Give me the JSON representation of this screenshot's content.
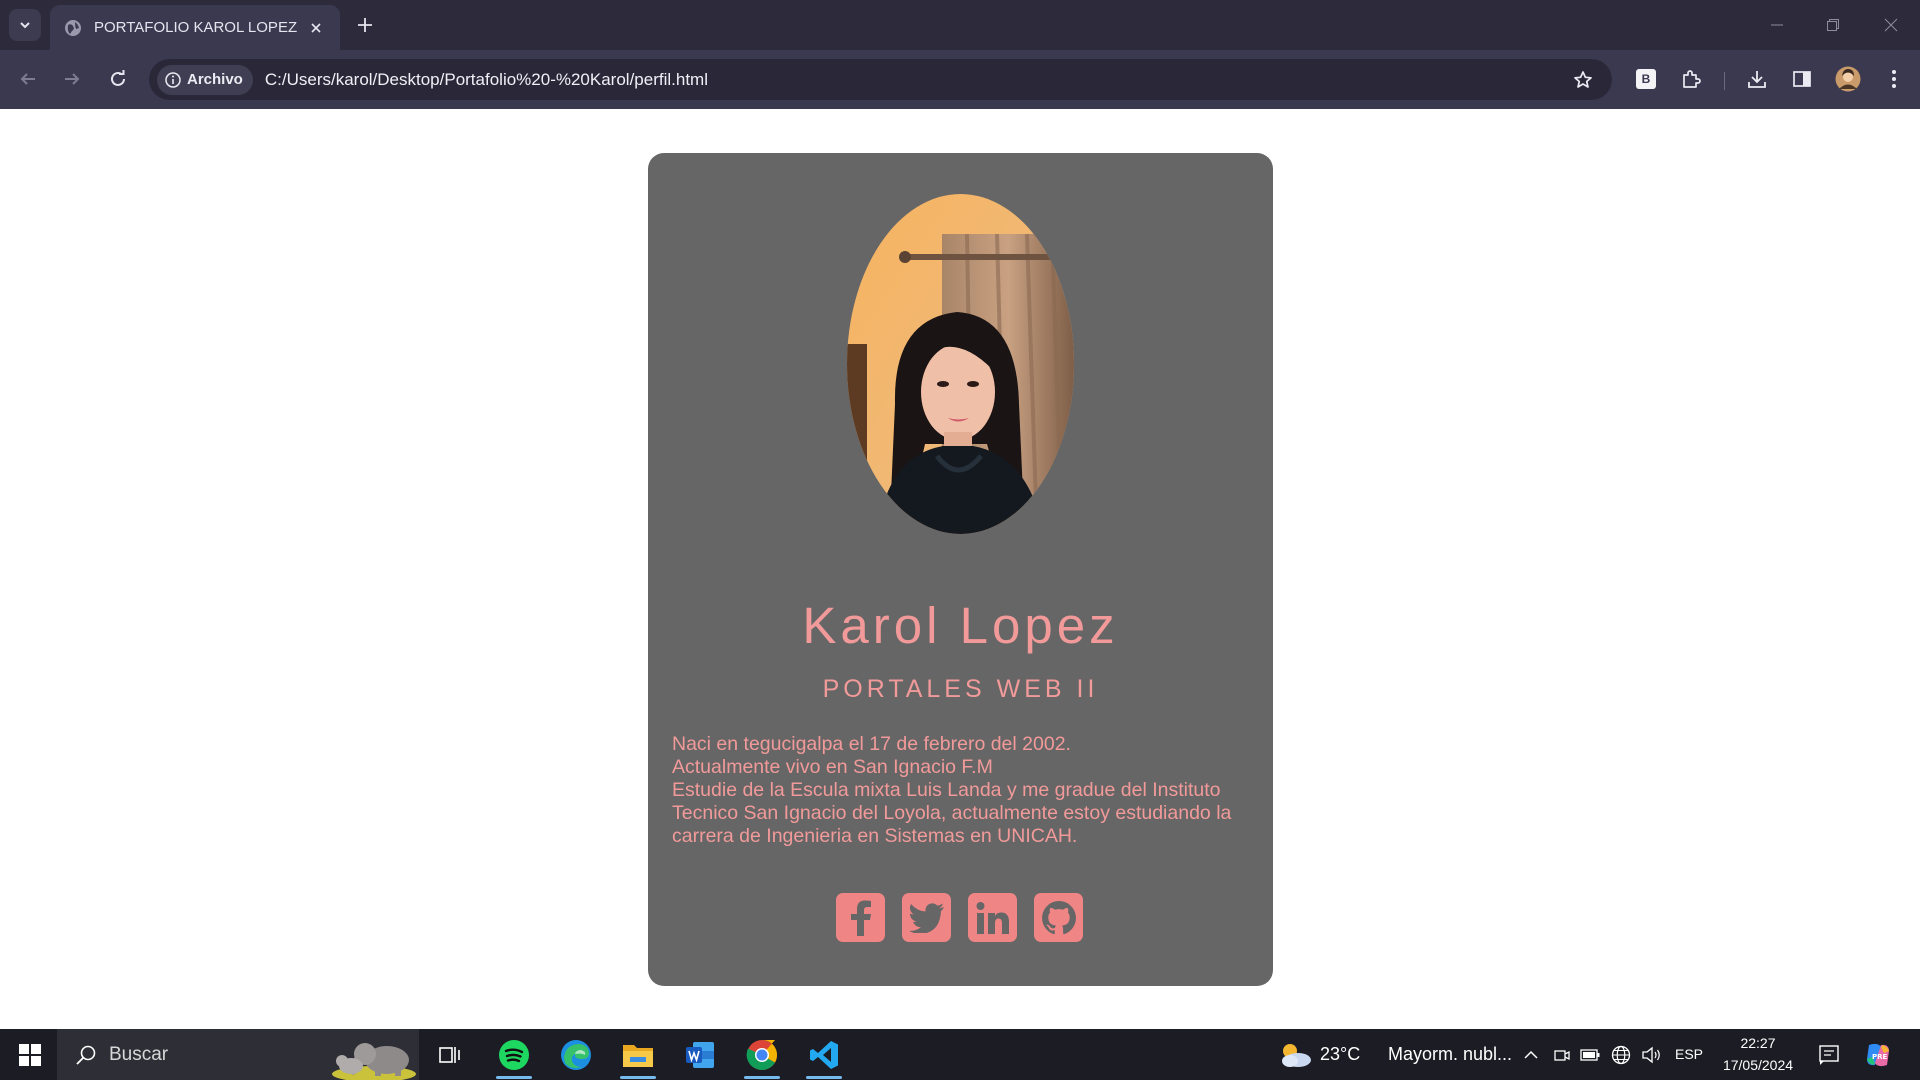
{
  "browser": {
    "tab_title": "PORTAFOLIO KAROL LOPEZ",
    "site_chip_label": "Archivo",
    "url": "C:/Users/karol/Desktop/Portafolio%20-%20Karol/perfil.html",
    "extension_badge": "B",
    "accent_color": "#3b3950"
  },
  "profile": {
    "name": "Karol Lopez",
    "subtitle": "PORTALES WEB II",
    "bio_lines": [
      "Naci en tegucigalpa el 17 de febrero del 2002.",
      "Actualmente vivo en San Ignacio F.M",
      "Estudie de la Escula mixta Luis Landa y me gradue del Instituto Tecnico San Ignacio del Loyola, actualmente estoy estudiando la carrera de Ingenieria en Sistemas en UNICAH."
    ],
    "text_color": "#f29a9a",
    "card_color": "#666666",
    "social_links": [
      "facebook-icon",
      "twitter-icon",
      "linkedin-icon",
      "github-icon"
    ]
  },
  "taskbar": {
    "search_placeholder": "Buscar",
    "weather_temp": "23°C",
    "weather_desc": "Mayorm. nubl...",
    "language": "ESP",
    "time": "22:27",
    "date": "17/05/2024",
    "apps": [
      "start-icon",
      "task-view-icon",
      "spotify-icon",
      "edge-icon",
      "file-explorer-icon",
      "word-icon",
      "chrome-icon",
      "vscode-icon"
    ]
  }
}
